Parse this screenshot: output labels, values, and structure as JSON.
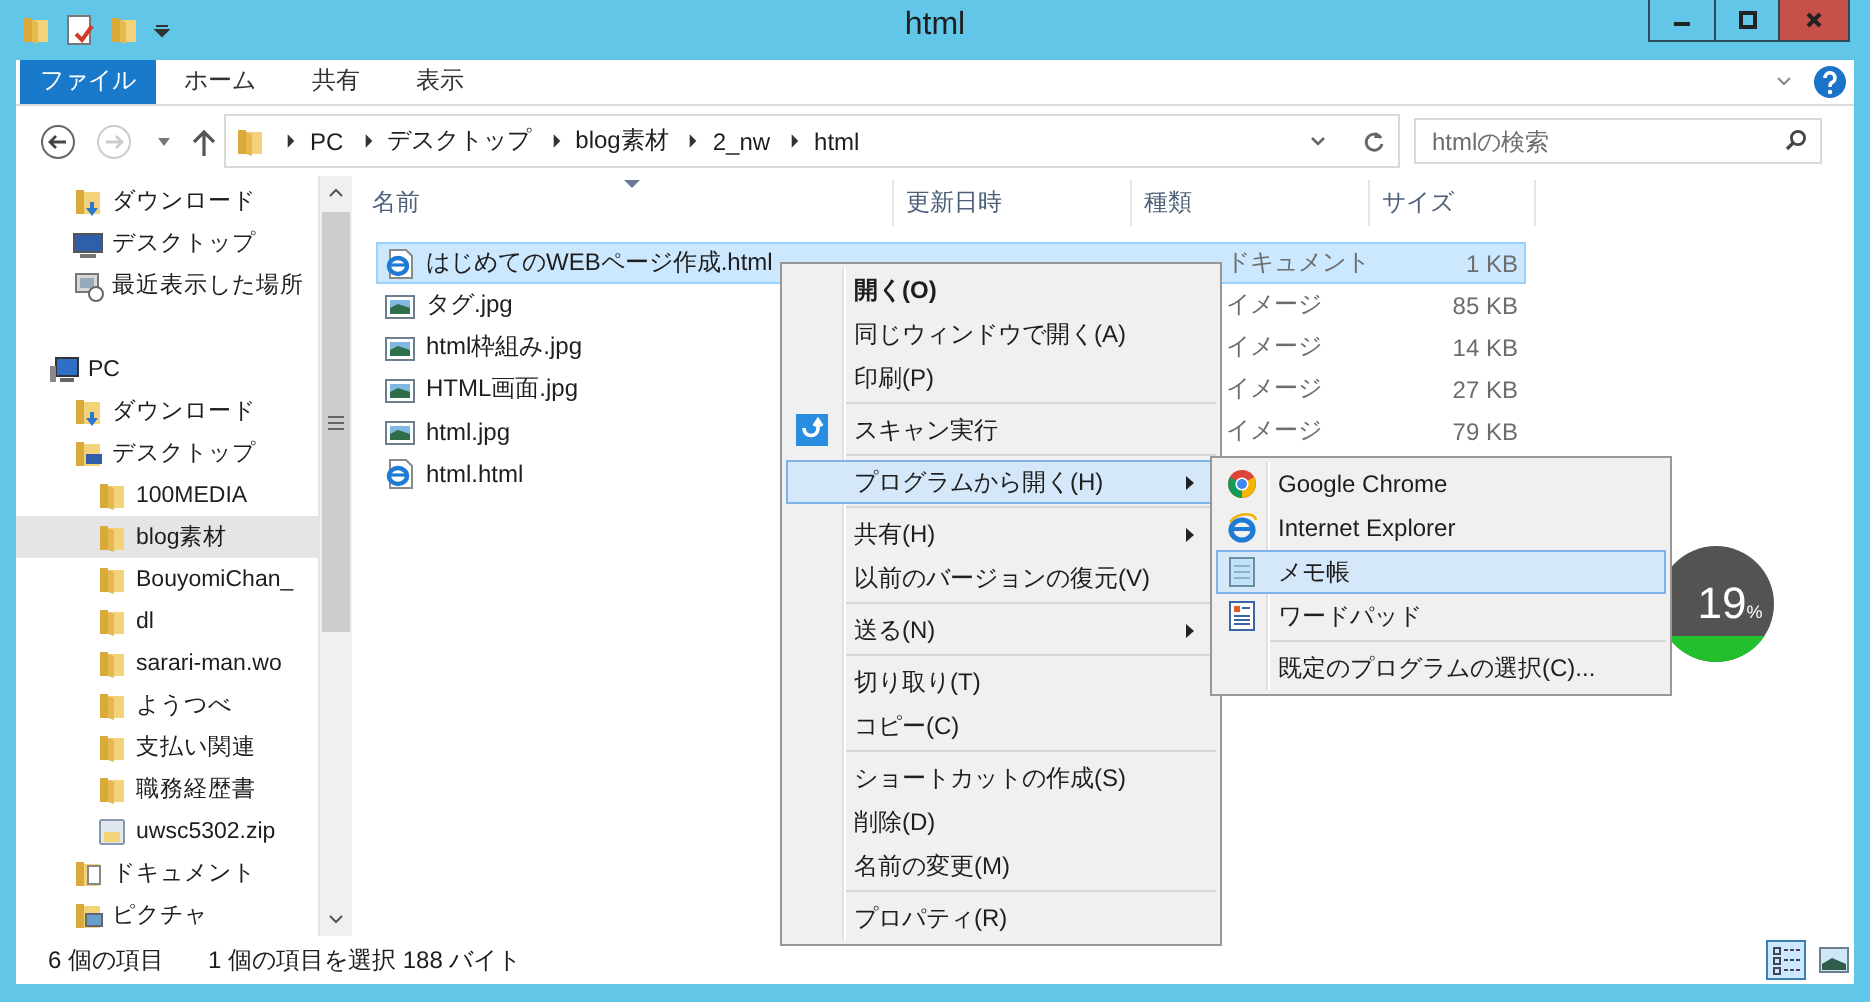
{
  "window": {
    "title": "html"
  },
  "ribbon_tabs": [
    {
      "label": "ファイル",
      "kind": "file"
    },
    {
      "label": "ホーム",
      "kind": "tab"
    },
    {
      "label": "共有",
      "kind": "tab"
    },
    {
      "label": "表示",
      "kind": "tab"
    }
  ],
  "address_bar": {
    "segments": [
      "PC",
      "デスクトップ",
      "blog素材",
      "2_nw",
      "html"
    ]
  },
  "search": {
    "placeholder": "htmlの検索"
  },
  "nav_pane": {
    "sections": [
      {
        "items": [
          {
            "label": "ダウンロード",
            "kind": "download",
            "selected": false
          },
          {
            "label": "デスクトップ",
            "kind": "desktop",
            "selected": false
          },
          {
            "label": "最近表示した場所",
            "kind": "recent",
            "selected": false
          }
        ]
      },
      {
        "items": [
          {
            "label": "PC",
            "kind": "pc",
            "selected": false,
            "children": [
              {
                "label": "ダウンロード",
                "kind": "download",
                "selected": false
              },
              {
                "label": "デスクトップ",
                "kind": "desktop-folder",
                "selected": false,
                "children": [
                  {
                    "label": "100MEDIA",
                    "kind": "folder",
                    "selected": false
                  },
                  {
                    "label": "blog素材",
                    "kind": "folder",
                    "selected": true
                  },
                  {
                    "label": "BouyomiChan_",
                    "kind": "folder",
                    "selected": false
                  },
                  {
                    "label": "dl",
                    "kind": "folder",
                    "selected": false
                  },
                  {
                    "label": "sarari-man.wo",
                    "kind": "folder",
                    "selected": false
                  },
                  {
                    "label": "ようつべ",
                    "kind": "folder",
                    "selected": false
                  },
                  {
                    "label": "支払い関連",
                    "kind": "folder",
                    "selected": false
                  },
                  {
                    "label": "職務経歴書",
                    "kind": "folder",
                    "selected": false
                  },
                  {
                    "label": "uwsc5302.zip",
                    "kind": "zip",
                    "selected": false
                  }
                ]
              },
              {
                "label": "ドキュメント",
                "kind": "documents",
                "selected": false
              },
              {
                "label": "ピクチャ",
                "kind": "pictures",
                "selected": false
              }
            ]
          }
        ]
      }
    ]
  },
  "file_list": {
    "columns": [
      "名前",
      "更新日時",
      "種類",
      "サイズ"
    ],
    "rows": [
      {
        "name": "はじめてのWEBページ作成.html",
        "kind": "html",
        "type": "ドキュメント",
        "size": "1 KB",
        "selected": true
      },
      {
        "name": "タグ.jpg",
        "kind": "image",
        "type": "イメージ",
        "size": "85 KB",
        "selected": false
      },
      {
        "name": "html枠組み.jpg",
        "kind": "image",
        "type": "イメージ",
        "size": "14 KB",
        "selected": false
      },
      {
        "name": "HTML画面.jpg",
        "kind": "image",
        "type": "イメージ",
        "size": "27 KB",
        "selected": false
      },
      {
        "name": "html.jpg",
        "kind": "image",
        "type": "イメージ",
        "size": "79 KB",
        "selected": false
      },
      {
        "name": "html.html",
        "kind": "html",
        "selected": false
      }
    ]
  },
  "context_menu": {
    "groups": [
      [
        {
          "label": "開く(O)",
          "bold": true,
          "highlighted": false
        },
        {
          "label": "同じウィンドウで開く(A)",
          "highlighted": false
        },
        {
          "label": "印刷(P)",
          "highlighted": false
        }
      ],
      [
        {
          "label": "スキャン実行",
          "kind": "scan",
          "highlighted": false
        }
      ],
      [
        {
          "label": "プログラムから開く(H)",
          "submenu": true,
          "highlighted": true
        }
      ],
      [
        {
          "label": "共有(H)",
          "submenu": true,
          "highlighted": false
        },
        {
          "label": "以前のバージョンの復元(V)",
          "highlighted": false
        }
      ],
      [
        {
          "label": "送る(N)",
          "submenu": true,
          "highlighted": false
        }
      ],
      [
        {
          "label": "切り取り(T)",
          "highlighted": false
        },
        {
          "label": "コピー(C)",
          "highlighted": false
        }
      ],
      [
        {
          "label": "ショートカットの作成(S)",
          "highlighted": false
        },
        {
          "label": "削除(D)",
          "highlighted": false
        },
        {
          "label": "名前の変更(M)",
          "highlighted": false
        }
      ],
      [
        {
          "label": "プロパティ(R)",
          "highlighted": false
        }
      ]
    ]
  },
  "submenu": {
    "groups": [
      [
        {
          "label": "Google Chrome",
          "kind": "chrome",
          "highlighted": false
        },
        {
          "label": "Internet Explorer",
          "kind": "ie",
          "highlighted": false
        },
        {
          "label": "メモ帳",
          "kind": "notepad",
          "highlighted": true
        },
        {
          "label": "ワードパッド",
          "kind": "wordpad",
          "highlighted": false
        }
      ],
      [
        {
          "label": "既定のプログラムの選択(C)...",
          "kind": "plain",
          "highlighted": false
        }
      ]
    ]
  },
  "meter_widget": {
    "value": "19",
    "unit": "%"
  },
  "status_bar": {
    "item_count": "6 個の項目",
    "selection": "1 個の項目を選択  188 バイト"
  },
  "view_buttons": [
    {
      "kind": "details",
      "selected": true
    },
    {
      "kind": "thumbnails",
      "selected": false
    }
  ]
}
